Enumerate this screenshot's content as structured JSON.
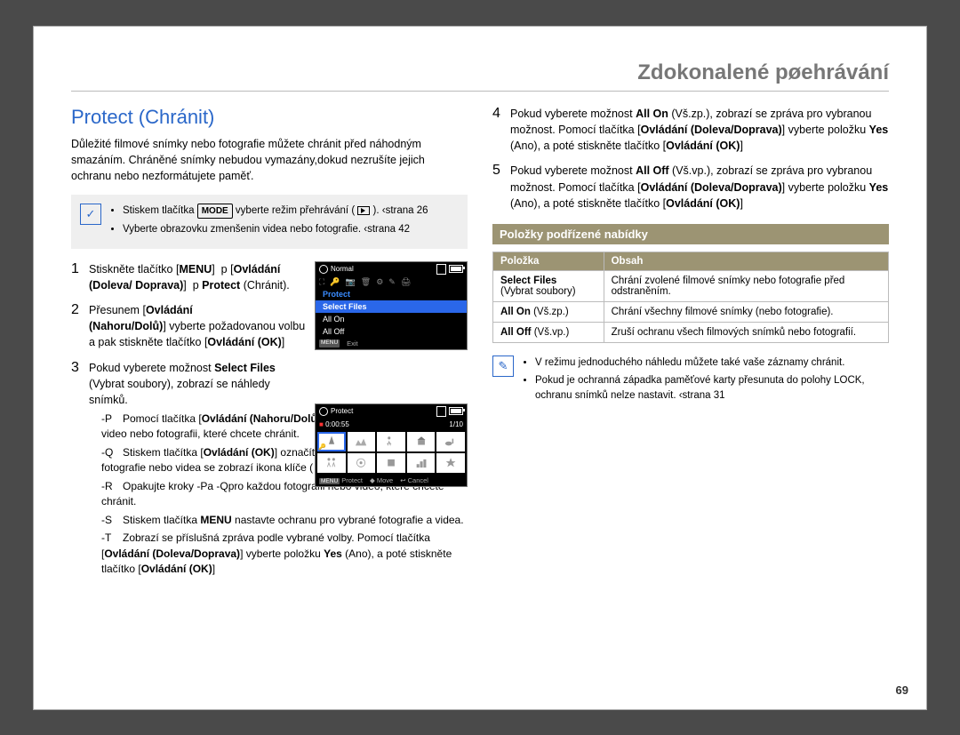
{
  "header": {
    "title": "Zdokonalené pøehrávání"
  },
  "pageNumber": "69",
  "left": {
    "sectionTitle": "Protect (Chránit)",
    "intro": "Důležité filmové snímky nebo fotografie můžete chránit před náhodným smazáním. Chráněné snímky nebudou vymazány,dokud nezrušíte jejich ochranu nebo nezformátujete paměť.",
    "note": [
      {
        "pre": "Stiskem tlačítka ",
        "mode": "MODE",
        "mid": " vyberte režim přehrávání ",
        "post": " ‹strana 26"
      },
      {
        "text": "Vyberte obrazovku zmenšenin videa nebo fotografie.  ‹strana 42"
      }
    ],
    "screen1": {
      "topLabel": "Normal",
      "menu": [
        "Protect",
        "Select Files",
        "All On",
        "All Off"
      ],
      "bottom": [
        {
          "tag": "MENU",
          "label": "Exit"
        }
      ]
    },
    "screen2": {
      "topLabel": "Protect",
      "time": "0:00:55",
      "counter": "1/10",
      "bottom": [
        {
          "tag": "MENU",
          "label": "Protect"
        },
        {
          "label": "Move"
        },
        {
          "label": "Cancel"
        }
      ]
    },
    "steps": [
      {
        "num": "1",
        "t1": "Stiskněte tlačítko",
        "b1": "MENU",
        "b2": "Ovládání (Doleva/ Doprava)",
        "b3": "Protect",
        "t2": "(Chránit)."
      },
      {
        "num": "2",
        "t1": "Přesunem",
        "b1": "Ovládání (Nahoru/Dolů)",
        "t2": "vyberte požadovanou volbu a pak stiskněte tlačítko ",
        "b2": "Ovládání (OK)",
        "t3": ""
      },
      {
        "num": "3",
        "t1": "Pokud vyberete možnost",
        "b1": "Select Files",
        "t2": "(Vybrat soubory), zobrazí se náhledy snímků.",
        "sub": [
          {
            "t1": "Pomocí tlačítka ",
            "b1": "Ovládání (Nahoru/Dolů/Doleva/Doprava)",
            "t2": "přejděte na video nebo fotografii, které chcete chránit."
          },
          {
            "t1": "Stiskem tlačítka ",
            "b1": "Ovládání (OK)",
            "t2": " označíte snímky pro ochranu. U fotografie nebo videa se zobrazí ikona klíče",
            "t3": ""
          },
          {
            "t1": "Opakujte kroky  -Pa  -Qpro každou fotografii nebo video, které chcete chránit."
          },
          {
            "t1": "Stiskem tlačítka ",
            "b1": "MENU",
            "t2": " nastavte ochranu pro vybrané fotografie a videa."
          },
          {
            "t1": "Zobrazí se příslušná zpráva podle vybrané volby. Pomocí tlačítka ",
            "b1": "Ovládání (Doleva/Doprava)",
            "t2": " vyberte položku",
            "b2": "Yes",
            "t3": "(Ano), a poté stiskněte tlačítko ",
            "b3": "Ovládání (OK)",
            "t4": ""
          }
        ]
      }
    ]
  },
  "right": {
    "steps": [
      {
        "num": "4",
        "t1": "Pokud vyberete možnost",
        "b1": "All On",
        "t2": "(Vš.zp.), zobrazí se zpráva pro vybranou možnost. Pomocí tlačítka",
        "b2": "Ovládání (Doleva/Doprava)",
        "t3": "vyberte položku",
        "b3": "Yes",
        "t4": "(Ano), a poté stiskněte tlačítko",
        "b4": "Ovládání (OK)",
        "t5": ""
      },
      {
        "num": "5",
        "t1": "Pokud vyberete možnost",
        "b1": "All Off",
        "t2": "(Vš.vp.), zobrazí se zpráva pro vybranou možnost. Pomocí tlačítka",
        "b2": "Ovládání (Doleva/Doprava)",
        "t3": "vyberte položku",
        "b3": "Yes",
        "t4": "(Ano), a poté stiskněte tlačítko",
        "b4": "Ovládání (OK)",
        "t5": ""
      }
    ],
    "submenu": {
      "heading": "Položky podřízené nabídky",
      "headers": [
        "Položka",
        "Obsah"
      ],
      "rows": [
        {
          "itemBold": "Select Files",
          "itemPlain": "(Vybrat soubory)",
          "desc": "Chrání zvolené filmové snímky nebo fotografie před odstraněním."
        },
        {
          "itemBold": "All On",
          "itemPlain": "(Vš.zp.)",
          "desc": "Chrání všechny filmové snímky (nebo fotografie)."
        },
        {
          "itemBold": "All Off",
          "itemPlain": "(Vš.vp.)",
          "desc": "Zruší ochranu všech filmových snímků nebo fotografií."
        }
      ]
    },
    "tips": [
      "V režimu jednoduchého náhledu můžete také vaše záznamy chránit.",
      "Pokud je ochranná západka paměťové karty přesunuta do polohy LOCK, ochranu snímků nelze nastavit.  ‹strana 31"
    ]
  }
}
